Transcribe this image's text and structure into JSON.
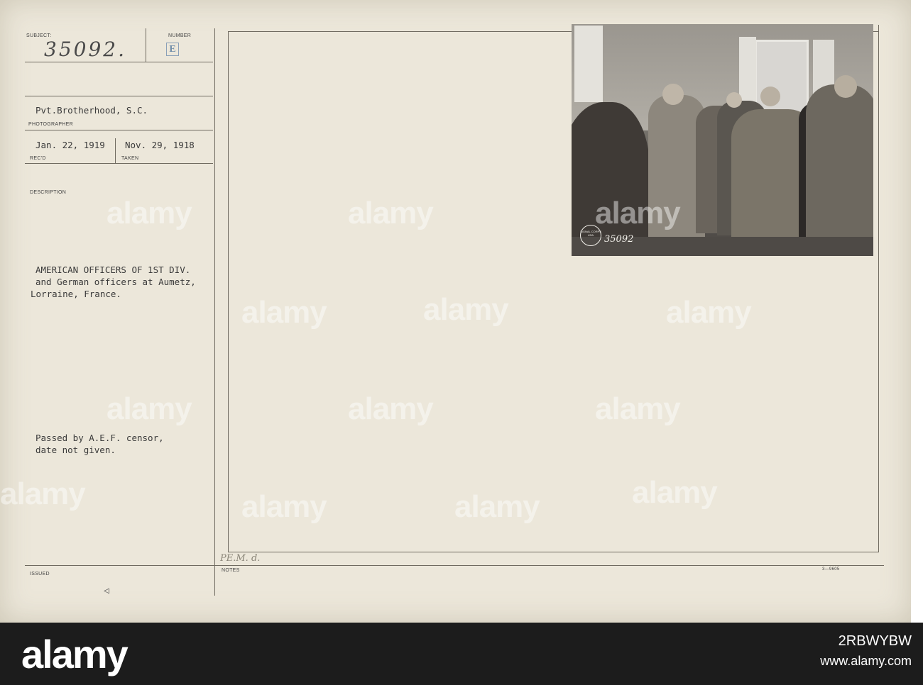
{
  "record": {
    "subject_label": "SUBJECT:",
    "subject_number": "35092.",
    "number_label": "NUMBER",
    "number_value": "E",
    "photographer": "Pvt.Brotherhood, S.C.",
    "photographer_label": "PHOTOGRAPHER",
    "received_date": "Jan. 22, 1919",
    "received_label": "REC'D",
    "taken_date": "Nov. 29, 1918",
    "taken_label": "TAKEN",
    "description_label": "DESCRIPTION",
    "description_lines": [
      "AMERICAN OFFICERS OF 1ST DIV.",
      "and German officers at Aumetz,",
      "Lorraine, France."
    ],
    "censor_lines": [
      "Passed by A.E.F. censor,",
      "date not given."
    ],
    "issued_label": "ISSUED",
    "notes_label": "NOTES",
    "notes_handwritten": "PE.M. d.",
    "form_code": "3—9605",
    "arrow_mark": "▷"
  },
  "photo": {
    "stamp_number": "35092",
    "stamp_text": "SIGNAL CORPS USA"
  },
  "watermark": {
    "text": "alamy"
  },
  "brand_strip": {
    "logo": "alamy",
    "image_id_label": "2RBWYBW",
    "meta_lines": [
      "www.alamy.com"
    ]
  }
}
